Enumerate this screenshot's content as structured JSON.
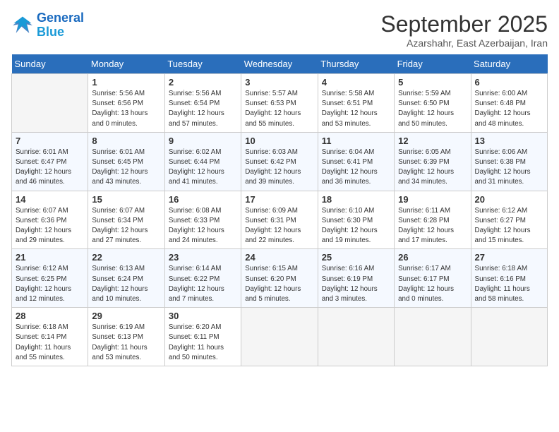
{
  "logo": {
    "line1": "General",
    "line2": "Blue"
  },
  "title": "September 2025",
  "subtitle": "Azarshahr, East Azerbaijan, Iran",
  "days_header": [
    "Sunday",
    "Monday",
    "Tuesday",
    "Wednesday",
    "Thursday",
    "Friday",
    "Saturday"
  ],
  "weeks": [
    [
      {
        "num": "",
        "info": ""
      },
      {
        "num": "1",
        "info": "Sunrise: 5:56 AM\nSunset: 6:56 PM\nDaylight: 13 hours\nand 0 minutes."
      },
      {
        "num": "2",
        "info": "Sunrise: 5:56 AM\nSunset: 6:54 PM\nDaylight: 12 hours\nand 57 minutes."
      },
      {
        "num": "3",
        "info": "Sunrise: 5:57 AM\nSunset: 6:53 PM\nDaylight: 12 hours\nand 55 minutes."
      },
      {
        "num": "4",
        "info": "Sunrise: 5:58 AM\nSunset: 6:51 PM\nDaylight: 12 hours\nand 53 minutes."
      },
      {
        "num": "5",
        "info": "Sunrise: 5:59 AM\nSunset: 6:50 PM\nDaylight: 12 hours\nand 50 minutes."
      },
      {
        "num": "6",
        "info": "Sunrise: 6:00 AM\nSunset: 6:48 PM\nDaylight: 12 hours\nand 48 minutes."
      }
    ],
    [
      {
        "num": "7",
        "info": "Sunrise: 6:01 AM\nSunset: 6:47 PM\nDaylight: 12 hours\nand 46 minutes."
      },
      {
        "num": "8",
        "info": "Sunrise: 6:01 AM\nSunset: 6:45 PM\nDaylight: 12 hours\nand 43 minutes."
      },
      {
        "num": "9",
        "info": "Sunrise: 6:02 AM\nSunset: 6:44 PM\nDaylight: 12 hours\nand 41 minutes."
      },
      {
        "num": "10",
        "info": "Sunrise: 6:03 AM\nSunset: 6:42 PM\nDaylight: 12 hours\nand 39 minutes."
      },
      {
        "num": "11",
        "info": "Sunrise: 6:04 AM\nSunset: 6:41 PM\nDaylight: 12 hours\nand 36 minutes."
      },
      {
        "num": "12",
        "info": "Sunrise: 6:05 AM\nSunset: 6:39 PM\nDaylight: 12 hours\nand 34 minutes."
      },
      {
        "num": "13",
        "info": "Sunrise: 6:06 AM\nSunset: 6:38 PM\nDaylight: 12 hours\nand 31 minutes."
      }
    ],
    [
      {
        "num": "14",
        "info": "Sunrise: 6:07 AM\nSunset: 6:36 PM\nDaylight: 12 hours\nand 29 minutes."
      },
      {
        "num": "15",
        "info": "Sunrise: 6:07 AM\nSunset: 6:34 PM\nDaylight: 12 hours\nand 27 minutes."
      },
      {
        "num": "16",
        "info": "Sunrise: 6:08 AM\nSunset: 6:33 PM\nDaylight: 12 hours\nand 24 minutes."
      },
      {
        "num": "17",
        "info": "Sunrise: 6:09 AM\nSunset: 6:31 PM\nDaylight: 12 hours\nand 22 minutes."
      },
      {
        "num": "18",
        "info": "Sunrise: 6:10 AM\nSunset: 6:30 PM\nDaylight: 12 hours\nand 19 minutes."
      },
      {
        "num": "19",
        "info": "Sunrise: 6:11 AM\nSunset: 6:28 PM\nDaylight: 12 hours\nand 17 minutes."
      },
      {
        "num": "20",
        "info": "Sunrise: 6:12 AM\nSunset: 6:27 PM\nDaylight: 12 hours\nand 15 minutes."
      }
    ],
    [
      {
        "num": "21",
        "info": "Sunrise: 6:12 AM\nSunset: 6:25 PM\nDaylight: 12 hours\nand 12 minutes."
      },
      {
        "num": "22",
        "info": "Sunrise: 6:13 AM\nSunset: 6:24 PM\nDaylight: 12 hours\nand 10 minutes."
      },
      {
        "num": "23",
        "info": "Sunrise: 6:14 AM\nSunset: 6:22 PM\nDaylight: 12 hours\nand 7 minutes."
      },
      {
        "num": "24",
        "info": "Sunrise: 6:15 AM\nSunset: 6:20 PM\nDaylight: 12 hours\nand 5 minutes."
      },
      {
        "num": "25",
        "info": "Sunrise: 6:16 AM\nSunset: 6:19 PM\nDaylight: 12 hours\nand 3 minutes."
      },
      {
        "num": "26",
        "info": "Sunrise: 6:17 AM\nSunset: 6:17 PM\nDaylight: 12 hours\nand 0 minutes."
      },
      {
        "num": "27",
        "info": "Sunrise: 6:18 AM\nSunset: 6:16 PM\nDaylight: 11 hours\nand 58 minutes."
      }
    ],
    [
      {
        "num": "28",
        "info": "Sunrise: 6:18 AM\nSunset: 6:14 PM\nDaylight: 11 hours\nand 55 minutes."
      },
      {
        "num": "29",
        "info": "Sunrise: 6:19 AM\nSunset: 6:13 PM\nDaylight: 11 hours\nand 53 minutes."
      },
      {
        "num": "30",
        "info": "Sunrise: 6:20 AM\nSunset: 6:11 PM\nDaylight: 11 hours\nand 50 minutes."
      },
      {
        "num": "",
        "info": ""
      },
      {
        "num": "",
        "info": ""
      },
      {
        "num": "",
        "info": ""
      },
      {
        "num": "",
        "info": ""
      }
    ]
  ]
}
